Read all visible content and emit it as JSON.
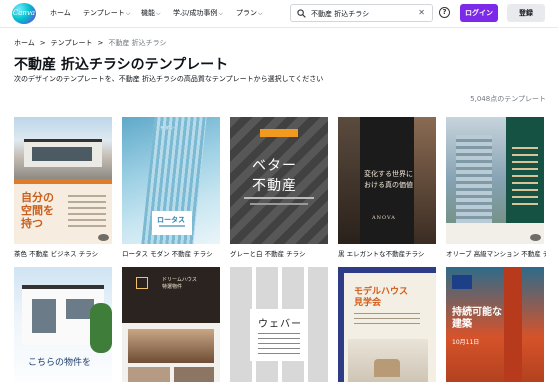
{
  "nav": {
    "logo": "Canva",
    "items": [
      "ホーム",
      "テンプレート",
      "機能",
      "学ぶ/成功事例",
      "プラン"
    ],
    "search_value": "不動産 折込チラシ",
    "login": "ログイン",
    "register": "登録",
    "help": "?"
  },
  "breadcrumb": [
    "ホーム",
    "テンプレート",
    "不動産 折込チラシ"
  ],
  "page": {
    "title": "不動産 折込チラシのテンプレート",
    "description": "次のデザインのテンプレートを、不動産 折込チラシの高品質なテンプレートから選択してください",
    "count": "5,048点のテンプレート"
  },
  "templates_row1": [
    {
      "label": "茶色 不動産 ビジネス チラシ",
      "thumb_text": "自分の\n空間を\n持つ"
    },
    {
      "label": "ロータス モダン 不動産 チラシ",
      "thumb_text": "ロータス",
      "thumb_top": "モダン"
    },
    {
      "label": "グレーと白 不動産 チラシ",
      "thumb_line1": "ベター",
      "thumb_line2": "不動産"
    },
    {
      "label": "黒 エレガントな不動産チラシ",
      "thumb_text": "変化する世界に\nおける真の価値",
      "thumb_brand": "ANOVA"
    },
    {
      "label": "オリーブ 高級マンション 不動産 チラシ"
    }
  ],
  "templates_row2": [
    {
      "thumb_text": "こちらの物件を"
    },
    {
      "thumb_text": "ドリームハウス\n特選物件"
    },
    {
      "thumb_text": "ウェバー"
    },
    {
      "thumb_title": "モデルハウス\n見学会"
    },
    {
      "thumb_title": "持続可能な\n建築",
      "thumb_date": "10月11日"
    }
  ],
  "colors": {
    "accent": "#7d2ae8",
    "text": "#0e1318",
    "muted": "#6f7780"
  },
  "icons": [
    "search-icon",
    "clear-icon",
    "help-icon",
    "chevron-down-icon",
    "eye-icon"
  ]
}
